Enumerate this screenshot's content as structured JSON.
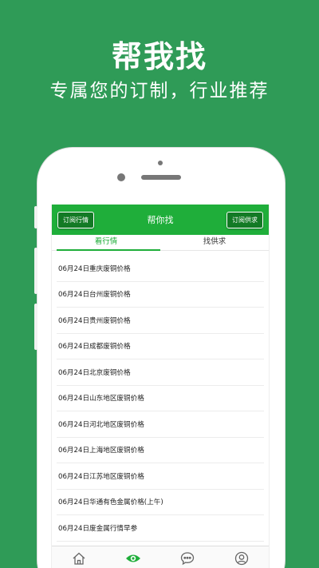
{
  "promo": {
    "title": "帮我找",
    "subtitle": "专属您的订制，行业推荐"
  },
  "app": {
    "header_title": "帮你找",
    "left_button": "订阅行情",
    "right_button": "订阅供求",
    "tabs": [
      {
        "label": "看行情",
        "active": true
      },
      {
        "label": "找供求",
        "active": false
      }
    ],
    "items": [
      "06月24日重庆废铜价格",
      "06月24日台州废铜价格",
      "06月24日贵州废铜价格",
      "06月24日成都废铜价格",
      "06月24日北京废铜价格",
      "06月24日山东地区废铜价格",
      "06月24日河北地区废铜价格",
      "06月24日上海地区废铜价格",
      "06月24日江苏地区废铜价格",
      "06月24日华通有色金属价格(上午)",
      "06月24日废金属行情早参"
    ],
    "bottom_nav": [
      {
        "icon": "home-icon",
        "active": false
      },
      {
        "icon": "eye-icon",
        "active": true
      },
      {
        "icon": "chat-icon",
        "active": false
      },
      {
        "icon": "user-icon",
        "active": false
      }
    ],
    "colors": {
      "brand_green": "#1fae3a",
      "background_green": "#2f9b57"
    }
  }
}
